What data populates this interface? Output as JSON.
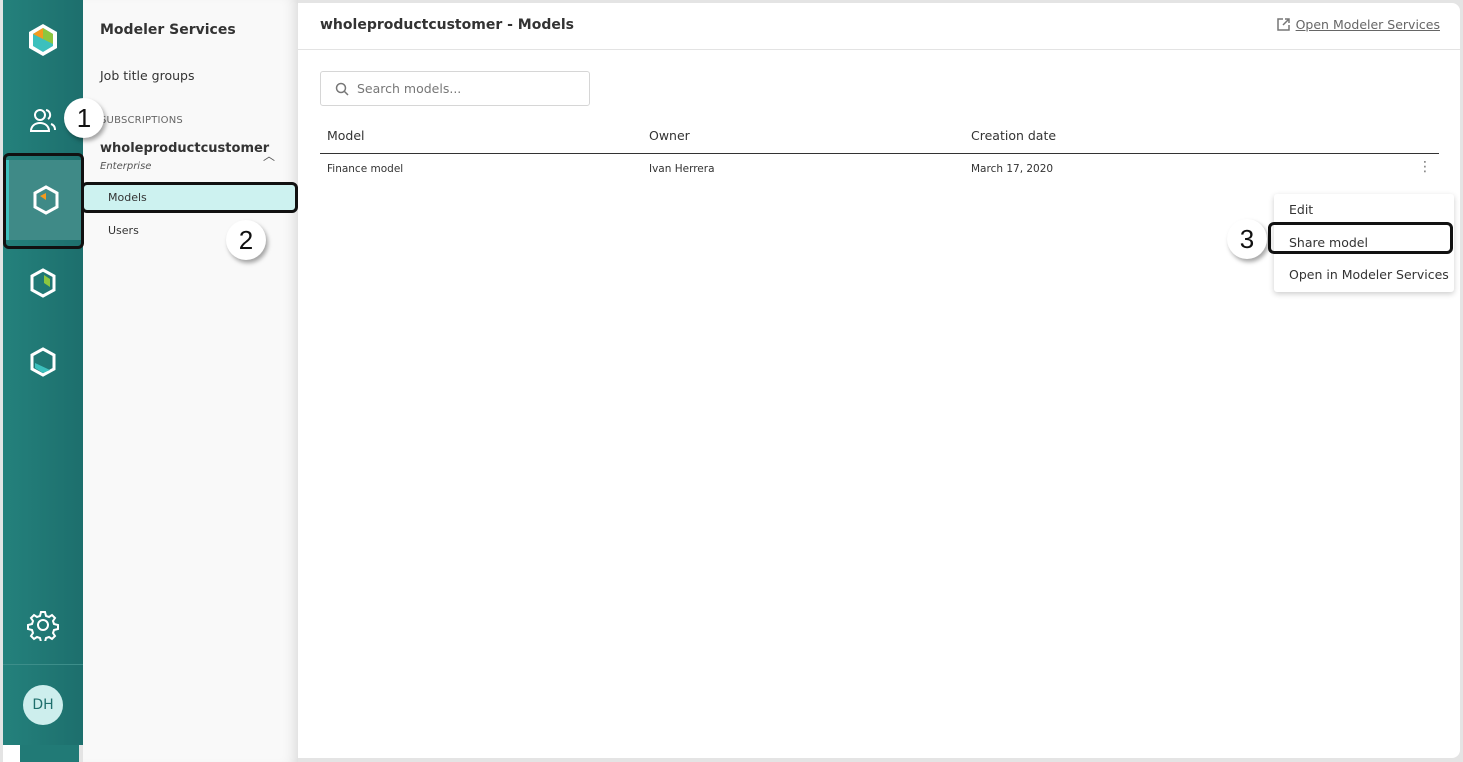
{
  "rail": {
    "icons": [
      "logo-icon",
      "users-icon",
      "modeler-icon",
      "analytics-icon",
      "integration-icon",
      "settings-icon"
    ],
    "avatar": "DH",
    "colors": {
      "teal": "#1f7875",
      "accent": "#3cc0bd",
      "orange": "#f39a1e",
      "green": "#8dc63f"
    }
  },
  "subnav": {
    "title": "Modeler Services",
    "job_title_groups": "Job title groups",
    "section": "SUBSCRIPTIONS",
    "subscription": "wholeproductcustomer",
    "plan": "Enterprise",
    "items": [
      {
        "label": "Models",
        "selected": true
      },
      {
        "label": "Users",
        "selected": false
      }
    ]
  },
  "main": {
    "title": "wholeproductcustomer - Models",
    "open_link": "Open Modeler Services",
    "search_placeholder": "Search models...",
    "columns": [
      "Model",
      "Owner",
      "Creation date"
    ],
    "rows": [
      {
        "model": "Finance model",
        "owner": "Ivan Herrera",
        "date": "March 17, 2020"
      }
    ],
    "menu": [
      "Edit",
      "Share model",
      "Open in Modeler Services"
    ]
  },
  "callouts": [
    "1",
    "2",
    "3"
  ]
}
